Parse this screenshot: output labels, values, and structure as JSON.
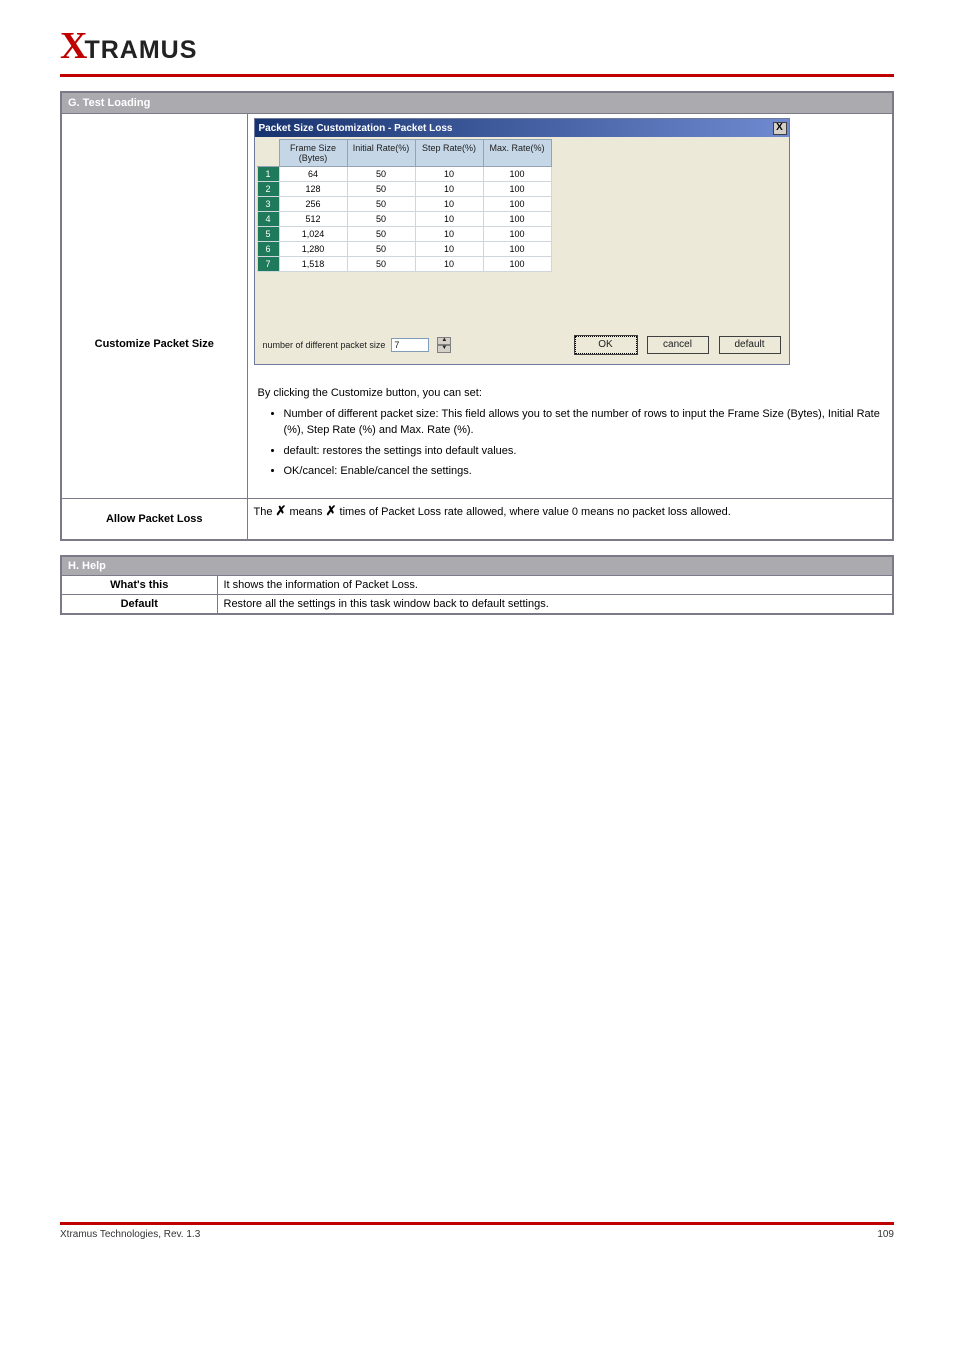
{
  "logo": {
    "x": "X",
    "rest": "TRAMUS"
  },
  "main_table": {
    "header": "G. Test Loading",
    "row1": {
      "left": "Customize Packet Size",
      "dialog": {
        "title": "Packet Size Customization - Packet Loss",
        "close": "X",
        "columns": [
          "Frame Size (Bytes)",
          "Initial Rate(%)",
          "Step Rate(%)",
          "Max. Rate(%)"
        ],
        "rows": [
          {
            "n": "1",
            "fs": "64",
            "ir": "50",
            "sr": "10",
            "mr": "100"
          },
          {
            "n": "2",
            "fs": "128",
            "ir": "50",
            "sr": "10",
            "mr": "100"
          },
          {
            "n": "3",
            "fs": "256",
            "ir": "50",
            "sr": "10",
            "mr": "100"
          },
          {
            "n": "4",
            "fs": "512",
            "ir": "50",
            "sr": "10",
            "mr": "100"
          },
          {
            "n": "5",
            "fs": "1,024",
            "ir": "50",
            "sr": "10",
            "mr": "100"
          },
          {
            "n": "6",
            "fs": "1,280",
            "ir": "50",
            "sr": "10",
            "mr": "100"
          },
          {
            "n": "7",
            "fs": "1,518",
            "ir": "50",
            "sr": "10",
            "mr": "100"
          }
        ],
        "numlabel": "number of different packet size",
        "numvalue": "7",
        "ok": "OK",
        "cancel": "cancel",
        "default": "default"
      },
      "desc_intro": "By clicking the Customize button, you can set:",
      "bullets": [
        "Number of different packet size: This field allows you to set the number of rows to input the Frame Size (Bytes), Initial Rate (%), Step Rate (%) and Max. Rate (%).",
        "default: restores the settings into default values.",
        "OK/cancel: Enable/cancel the settings."
      ]
    },
    "row2": {
      "left": "Allow Packet Loss",
      "right_pre": "The ",
      "right_x1": "✗",
      "right_mid": " means ",
      "right_x2": "✗",
      "right_post": " times of Packet Loss rate allowed, where value 0 means no packet loss allowed."
    }
  },
  "help_table": {
    "header": "H. Help",
    "rows": [
      {
        "l": "What's this",
        "r": "It shows the information of Packet Loss."
      },
      {
        "l": "Default",
        "r": "Restore all the settings in this task window back to default settings."
      }
    ]
  },
  "footer": {
    "left": "Xtramus Technologies, Rev. 1.3",
    "right": "109"
  }
}
